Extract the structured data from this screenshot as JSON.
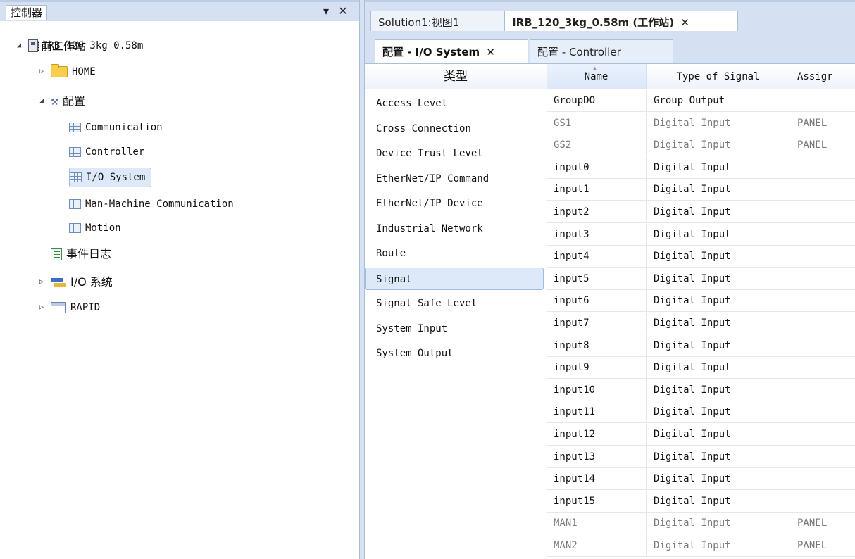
{
  "controller_panel": {
    "title": "控制器",
    "pin_glyph": "▾",
    "close_glyph": "✕",
    "station_heading": "当前工作站",
    "tree": [
      {
        "label": "IRB_120_3kg_0.58m",
        "icon": "controller-icon",
        "expander": "◢",
        "indent": 0
      },
      {
        "label": "HOME",
        "icon": "folder-icon",
        "expander": "▷",
        "indent": 1
      },
      {
        "label": "配置",
        "icon": "tools-icon",
        "expander": "◢",
        "indent": 1
      },
      {
        "label": "Communication",
        "icon": "table-icon",
        "expander": "",
        "indent": 2
      },
      {
        "label": "Controller",
        "icon": "table-icon",
        "expander": "",
        "indent": 2
      },
      {
        "label": "I/O System",
        "icon": "table-icon",
        "expander": "",
        "indent": 2,
        "selected": true
      },
      {
        "label": "Man-Machine Communication",
        "icon": "table-icon",
        "expander": "",
        "indent": 2
      },
      {
        "label": "Motion",
        "icon": "table-icon",
        "expander": "",
        "indent": 2
      },
      {
        "label": "事件日志",
        "icon": "event-log-icon",
        "expander": "",
        "indent": 1
      },
      {
        "label": "I/O 系统",
        "icon": "io-system-icon",
        "expander": "▷",
        "indent": 1
      },
      {
        "label": "RAPID",
        "icon": "rapid-icon",
        "expander": "▷",
        "indent": 1
      }
    ]
  },
  "document_tabs": [
    {
      "label": "Solution1:视图1",
      "active": false
    },
    {
      "label": "IRB_120_3kg_0.58m (工作站)",
      "active": true,
      "close": "✕"
    }
  ],
  "config_tabs": [
    {
      "label": "配置 - I/O System",
      "active": true,
      "close": "✕"
    },
    {
      "label": "配置 - Controller",
      "active": false
    }
  ],
  "types": {
    "header": "类型",
    "items": [
      "Access Level",
      "Cross Connection",
      "Device Trust Level",
      "EtherNet/IP Command",
      "EtherNet/IP Device",
      "Industrial Network",
      "Route",
      "Signal",
      "Signal Safe Level",
      "System Input",
      "System Output"
    ],
    "selected": "Signal"
  },
  "signal_grid": {
    "columns": [
      "Name",
      "Type of Signal",
      "Assigr"
    ],
    "sorted_column": "Name",
    "rows": [
      {
        "name": "GroupDO",
        "type": "Group Output",
        "assigned": "",
        "dim": false
      },
      {
        "name": "GS1",
        "type": "Digital Input",
        "assigned": "PANEL",
        "dim": true
      },
      {
        "name": "GS2",
        "type": "Digital Input",
        "assigned": "PANEL",
        "dim": true
      },
      {
        "name": "input0",
        "type": "Digital Input",
        "assigned": "",
        "dim": false
      },
      {
        "name": "input1",
        "type": "Digital Input",
        "assigned": "",
        "dim": false
      },
      {
        "name": "input2",
        "type": "Digital Input",
        "assigned": "",
        "dim": false
      },
      {
        "name": "input3",
        "type": "Digital Input",
        "assigned": "",
        "dim": false
      },
      {
        "name": "input4",
        "type": "Digital Input",
        "assigned": "",
        "dim": false
      },
      {
        "name": "input5",
        "type": "Digital Input",
        "assigned": "",
        "dim": false
      },
      {
        "name": "input6",
        "type": "Digital Input",
        "assigned": "",
        "dim": false
      },
      {
        "name": "input7",
        "type": "Digital Input",
        "assigned": "",
        "dim": false
      },
      {
        "name": "input8",
        "type": "Digital Input",
        "assigned": "",
        "dim": false
      },
      {
        "name": "input9",
        "type": "Digital Input",
        "assigned": "",
        "dim": false
      },
      {
        "name": "input10",
        "type": "Digital Input",
        "assigned": "",
        "dim": false
      },
      {
        "name": "input11",
        "type": "Digital Input",
        "assigned": "",
        "dim": false
      },
      {
        "name": "input12",
        "type": "Digital Input",
        "assigned": "",
        "dim": false
      },
      {
        "name": "input13",
        "type": "Digital Input",
        "assigned": "",
        "dim": false
      },
      {
        "name": "input14",
        "type": "Digital Input",
        "assigned": "",
        "dim": false
      },
      {
        "name": "input15",
        "type": "Digital Input",
        "assigned": "",
        "dim": false
      },
      {
        "name": "MAN1",
        "type": "Digital Input",
        "assigned": "PANEL",
        "dim": true
      },
      {
        "name": "MAN2",
        "type": "Digital Input",
        "assigned": "PANEL",
        "dim": true
      }
    ]
  }
}
